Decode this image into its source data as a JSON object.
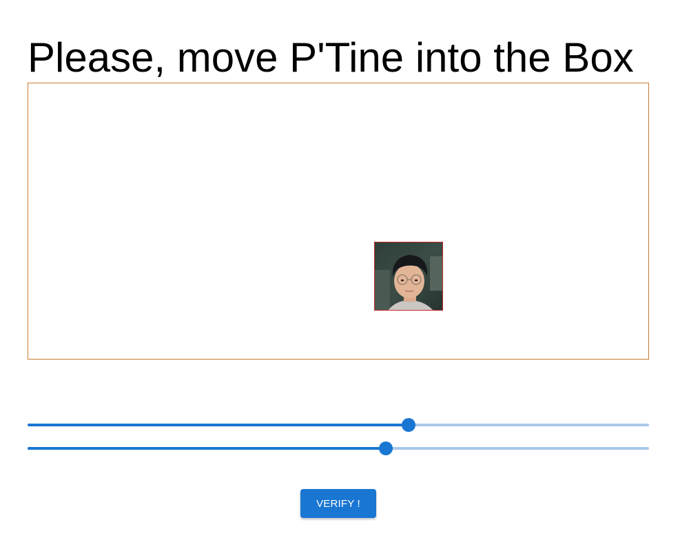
{
  "heading": "Please, move P'Tine into the Box",
  "avatar": {
    "icon": "person-photo-icon"
  },
  "sliders": [
    {
      "name": "horizontal-position",
      "value": 61.3,
      "min": 0,
      "max": 100
    },
    {
      "name": "vertical-position",
      "value": 57.6,
      "min": 0,
      "max": 100
    }
  ],
  "verify_button": {
    "label": "VERIFY !"
  },
  "colors": {
    "accent": "#1976d2",
    "rail": "#a9c9ea",
    "box_border": "#c77a2e",
    "avatar_border": "#c62828"
  }
}
